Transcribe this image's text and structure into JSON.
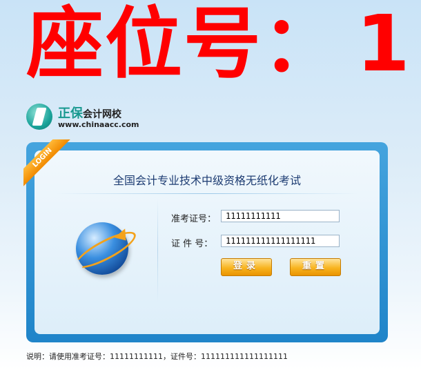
{
  "seat": {
    "label": "座位号：",
    "number": "1"
  },
  "brand": {
    "name_main": "正保",
    "name_sub": "会计网校",
    "url": "www.chinaacc.com",
    "logo_icon": "chinaacc-logo-icon",
    "color": "#17988f"
  },
  "panel": {
    "ribbon": "LOGIN",
    "title": "全国会计专业技术中级资格无纸化考试",
    "illustration_icon": "globe-arrow-icon",
    "fields": [
      {
        "label": "准考证号：",
        "value": "11111111111"
      },
      {
        "label": "证 件 号：",
        "value": "111111111111111111"
      }
    ],
    "buttons": {
      "login": "登录",
      "reset": "重置"
    },
    "colors": {
      "frame": "#2b8fd4",
      "button": "#f8b420"
    }
  },
  "note": "说明：请使用准考证号：11111111111，证件号：111111111111111111"
}
